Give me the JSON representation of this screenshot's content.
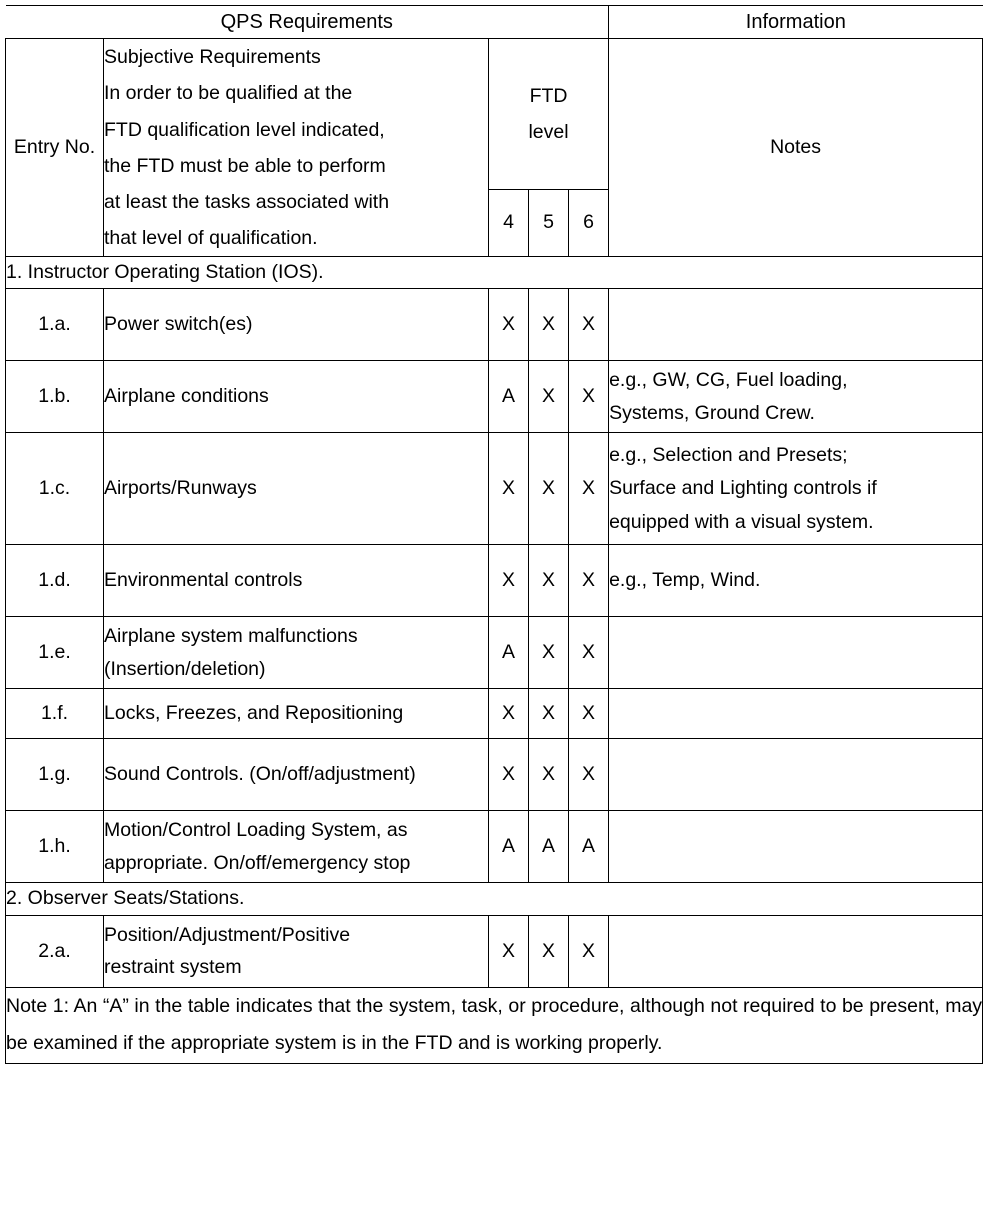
{
  "document": {
    "table_title_left": "QPS Requirements",
    "table_title_right": "Information"
  },
  "header": {
    "entry_no_line1": "Entry",
    "entry_no_line2": "No.",
    "subjective_title": "Subjective Requirements",
    "subjective_body_line1": "In order to be qualified at the",
    "subjective_body_line2": "FTD qualification level indicated,",
    "subjective_body_line3": "the FTD must be able to perform",
    "subjective_body_line4": "at least the tasks associated with",
    "subjective_body_line5": "that level of qualification.",
    "ftd_line1": "FTD",
    "ftd_line2": "level",
    "level_4": "4",
    "level_5": "5",
    "level_6": "6",
    "notes": "Notes"
  },
  "sections": [
    {
      "heading": "1. Instructor Operating Station (IOS).",
      "rows": [
        {
          "entry": "1.a.",
          "requirement_line1": "Power switch(es)",
          "requirement_line2": "",
          "l4": "X",
          "l5": "X",
          "l6": "X",
          "note_line1": "",
          "note_line2": "",
          "note_line3": ""
        },
        {
          "entry": "1.b.",
          "requirement_line1": "Airplane conditions",
          "requirement_line2": "",
          "l4": "A",
          "l5": "X",
          "l6": "X",
          "note_line1": "e.g., GW, CG, Fuel loading,",
          "note_line2": "Systems, Ground Crew.",
          "note_line3": ""
        },
        {
          "entry": "1.c.",
          "requirement_line1": "Airports/Runways",
          "requirement_line2": "",
          "l4": "X",
          "l5": "X",
          "l6": "X",
          "note_line1": "e.g., Selection and Presets;",
          "note_line2": "Surface and Lighting controls if",
          "note_line3": "equipped with a visual system."
        },
        {
          "entry": "1.d.",
          "requirement_line1": "Environmental controls",
          "requirement_line2": "",
          "l4": "X",
          "l5": "X",
          "l6": "X",
          "note_line1": "e.g., Temp, Wind.",
          "note_line2": "",
          "note_line3": ""
        },
        {
          "entry": "1.e.",
          "requirement_line1": "Airplane system malfunctions",
          "requirement_line2": "(Insertion/deletion)",
          "l4": "A",
          "l5": "X",
          "l6": "X",
          "note_line1": "",
          "note_line2": "",
          "note_line3": ""
        },
        {
          "entry": "1.f.",
          "requirement_line1": "Locks, Freezes, and Repositioning",
          "requirement_line2": "",
          "l4": "X",
          "l5": "X",
          "l6": "X",
          "note_line1": "",
          "note_line2": "",
          "note_line3": ""
        },
        {
          "entry": "1.g.",
          "requirement_line1": "Sound Controls. (On/off/adjustment)",
          "requirement_line2": "",
          "l4": "X",
          "l5": "X",
          "l6": "X",
          "note_line1": "",
          "note_line2": "",
          "note_line3": ""
        },
        {
          "entry": "1.h.",
          "requirement_line1": "Motion/Control Loading System, as",
          "requirement_line2": "appropriate. On/off/emergency stop",
          "l4": "A",
          "l5": "A",
          "l6": "A",
          "note_line1": "",
          "note_line2": "",
          "note_line3": ""
        }
      ]
    },
    {
      "heading": "2. Observer Seats/Stations.",
      "rows": [
        {
          "entry": "2.a.",
          "requirement_line1": "Position/Adjustment/Positive",
          "requirement_line2": "restraint system",
          "l4": "X",
          "l5": "X",
          "l6": "X",
          "note_line1": "",
          "note_line2": "",
          "note_line3": ""
        }
      ]
    }
  ],
  "footnote": {
    "text": "Note 1: An “A” in the table indicates that the system, task, or procedure, although not required to be present, may be examined if the appropriate system is in the FTD and is working properly."
  }
}
